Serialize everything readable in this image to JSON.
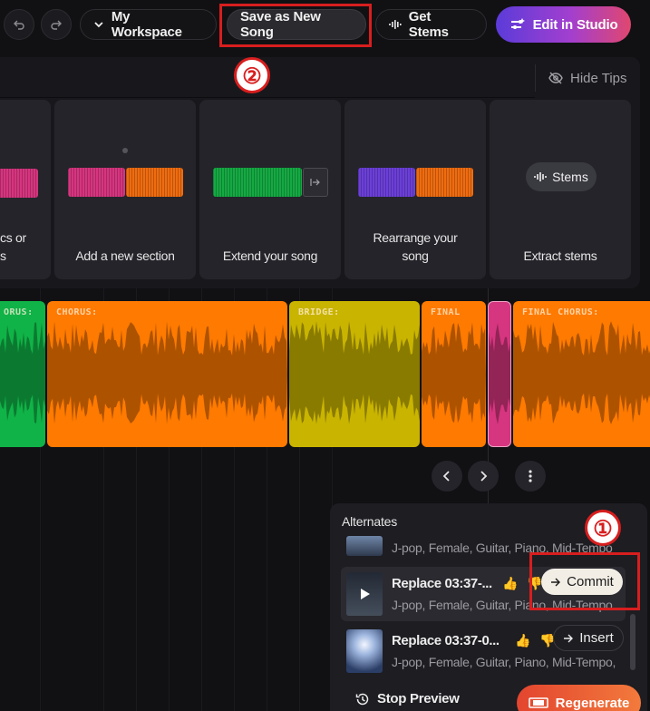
{
  "topbar": {
    "undo_icon": "undo-icon",
    "redo_icon": "redo-icon",
    "workspace_label": "My Workspace",
    "save_label": "Save as New Song",
    "stems_label": "Get Stems",
    "studio_label": "Edit in Studio"
  },
  "annotations": {
    "step1": "①",
    "step2": "②",
    "color": "#d81e1e"
  },
  "tips": {
    "hide_label": "Hide Tips",
    "cards": [
      {
        "label_line1": "cs or",
        "label_line2": "s"
      },
      {
        "label_line1": "Add a new section"
      },
      {
        "label_line1": "Extend your song"
      },
      {
        "label_line1": "Rearrange your",
        "label_line2": "song"
      },
      {
        "label_line1": "Extract stems",
        "chip": "Stems"
      }
    ]
  },
  "timeline": {
    "segments": [
      {
        "label": "ORUS:",
        "color": "#10b347"
      },
      {
        "label": "CHORUS:",
        "color": "#ff7a00"
      },
      {
        "label": "BRIDGE:",
        "color": "#c9b400"
      },
      {
        "label": "FINAL",
        "color": "#ff7a00"
      },
      {
        "label": "",
        "color": "#d6357f"
      },
      {
        "label": "FINAL CHORUS:",
        "color": "#ff7a00"
      }
    ]
  },
  "alternates": {
    "title": "Alternates",
    "rows": [
      {
        "name": "",
        "meta": "J-pop, Female, Guitar, Piano, Mid-Tempo"
      },
      {
        "name": "Replace 03:37-...",
        "meta": "J-pop, Female, Guitar, Piano, Mid-Tempo",
        "action": "Commit"
      },
      {
        "name": "Replace 03:37-0...",
        "meta": "J-pop, Female, Guitar, Piano, Mid-Tempo,",
        "action": "Insert"
      }
    ],
    "stop_label": "Stop Preview",
    "regenerate_label": "Regenerate"
  }
}
